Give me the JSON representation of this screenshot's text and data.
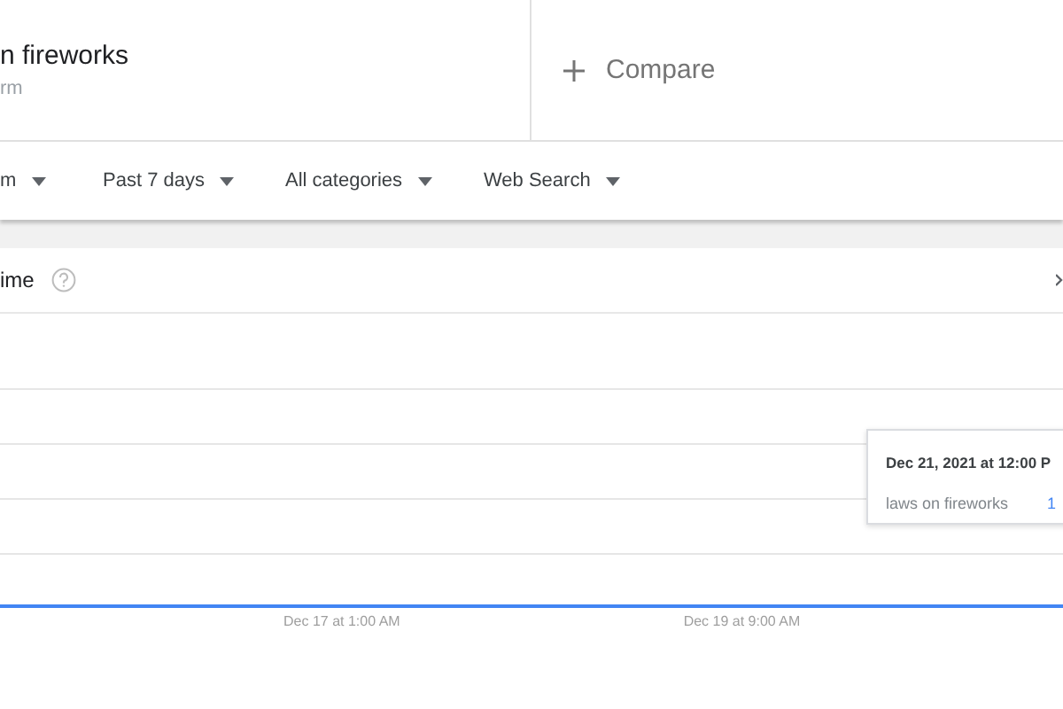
{
  "term": {
    "title": "n fireworks",
    "subtitle": "rm"
  },
  "compare": {
    "label": "Compare"
  },
  "filters": [
    {
      "label": "m"
    },
    {
      "label": "Past 7 days"
    },
    {
      "label": "All categories"
    },
    {
      "label": "Web Search"
    }
  ],
  "card": {
    "title": "ime"
  },
  "chart": {
    "x_labels": [
      "Dec 17 at 1:00 AM",
      "Dec 19 at 9:00 AM"
    ]
  },
  "tooltip": {
    "date": "Dec 21, 2021 at 12:00 P",
    "series": "laws on fireworks",
    "value": "1"
  }
}
